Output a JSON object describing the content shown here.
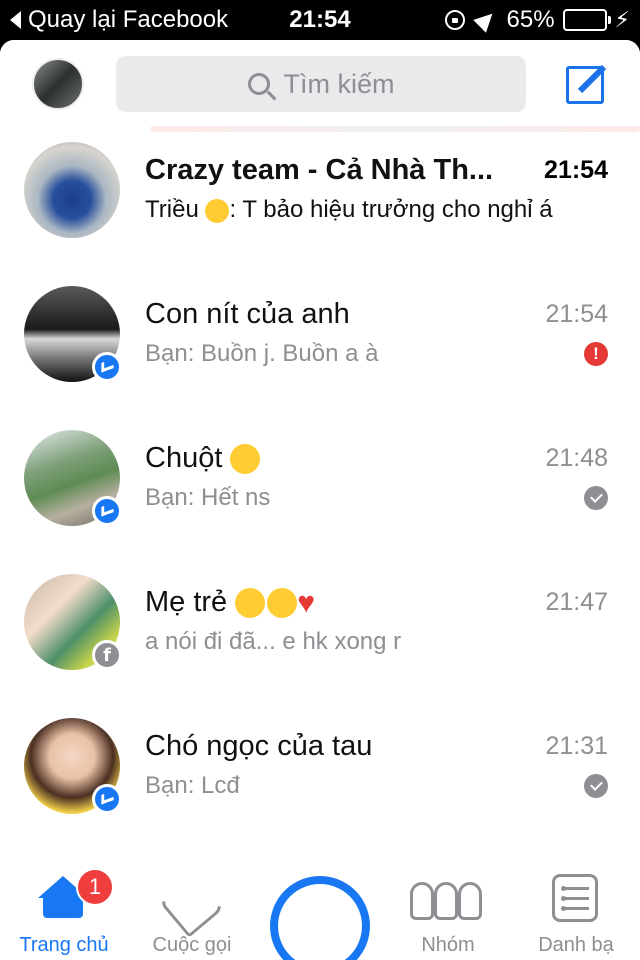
{
  "status_bar": {
    "back_label": "Quay lại Facebook",
    "time": "21:54",
    "battery_percent": "65%",
    "battery_level": 0.65,
    "icons": [
      "orientation-lock-icon",
      "location-icon",
      "battery-icon",
      "charging-bolt-icon"
    ]
  },
  "header": {
    "search_placeholder": "Tìm kiếm",
    "icons": [
      "profile-avatar",
      "search-icon",
      "compose-icon"
    ]
  },
  "conversations": [
    {
      "name": "Crazy team - Cả Nhà Th...",
      "time": "21:54",
      "preview_sender": "Triều",
      "preview_text": ": T bảo hiệu trưởng cho nghỉ á",
      "unread": true,
      "status": "none",
      "badge": "none"
    },
    {
      "name": "Con nít của anh",
      "time": "21:54",
      "preview_text": "Bạn: Buồn j. Buồn a à",
      "unread": false,
      "status": "error",
      "status_symbol": "!",
      "badge": "messenger"
    },
    {
      "name": "Chuột",
      "time": "21:48",
      "preview_text": "Bạn: Hết ns",
      "unread": false,
      "status": "seen",
      "badge": "messenger"
    },
    {
      "name": "Mẹ trẻ",
      "time": "21:47",
      "preview_text": "a nói đi đã... e hk xong r",
      "unread": false,
      "status": "none",
      "badge": "facebook",
      "badge_symbol": "f"
    },
    {
      "name": "Chó ngọc của tau",
      "time": "21:31",
      "preview_text": "Bạn: Lcđ",
      "unread": false,
      "status": "seen",
      "badge": "messenger"
    }
  ],
  "tabbar": {
    "home_label": "Trang chủ",
    "home_badge": "1",
    "calls_label": "Cuộc gọi",
    "groups_label": "Nhóm",
    "contacts_label": "Danh bạ",
    "active_tab": "home"
  },
  "colors": {
    "accent": "#1877f2",
    "error": "#e53935",
    "badge_red": "#f03e3e",
    "muted_text": "#8e8e93",
    "battery_green": "#4cd964"
  }
}
